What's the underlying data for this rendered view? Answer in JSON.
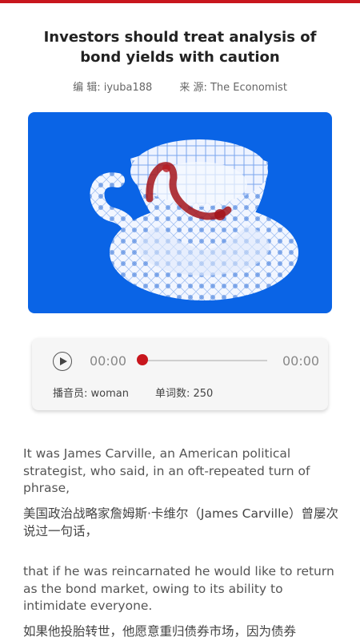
{
  "article": {
    "title": "Investors should treat analysis of bond yields with caution",
    "editor_label": "编 辑: iyuba188",
    "source_label": "来 源: The Economist"
  },
  "hero_image": {
    "background_color": "#0a64e6",
    "subject": "porcelain teacup with tea leaves"
  },
  "player": {
    "current_time": "00:00",
    "total_time": "00:00",
    "progress": 0,
    "reader_label": "播音员: woman",
    "wordcount_label": "单词数: 250",
    "accent_color": "#c8161d"
  },
  "paragraphs": [
    {
      "en": "It was James Carville, an American political strategist, who said, in an oft-repeated turn of phrase,",
      "zh": "美国政治战略家詹姆斯·卡维尔（James Carville）曾屡次说过一句话，"
    },
    {
      "en": "that if he was reincarnated he would like to return as the bond market, owing to its ability to intimidate everyone.",
      "zh": "如果他投胎转世，他愿意重归债券市场，因为债券"
    }
  ]
}
